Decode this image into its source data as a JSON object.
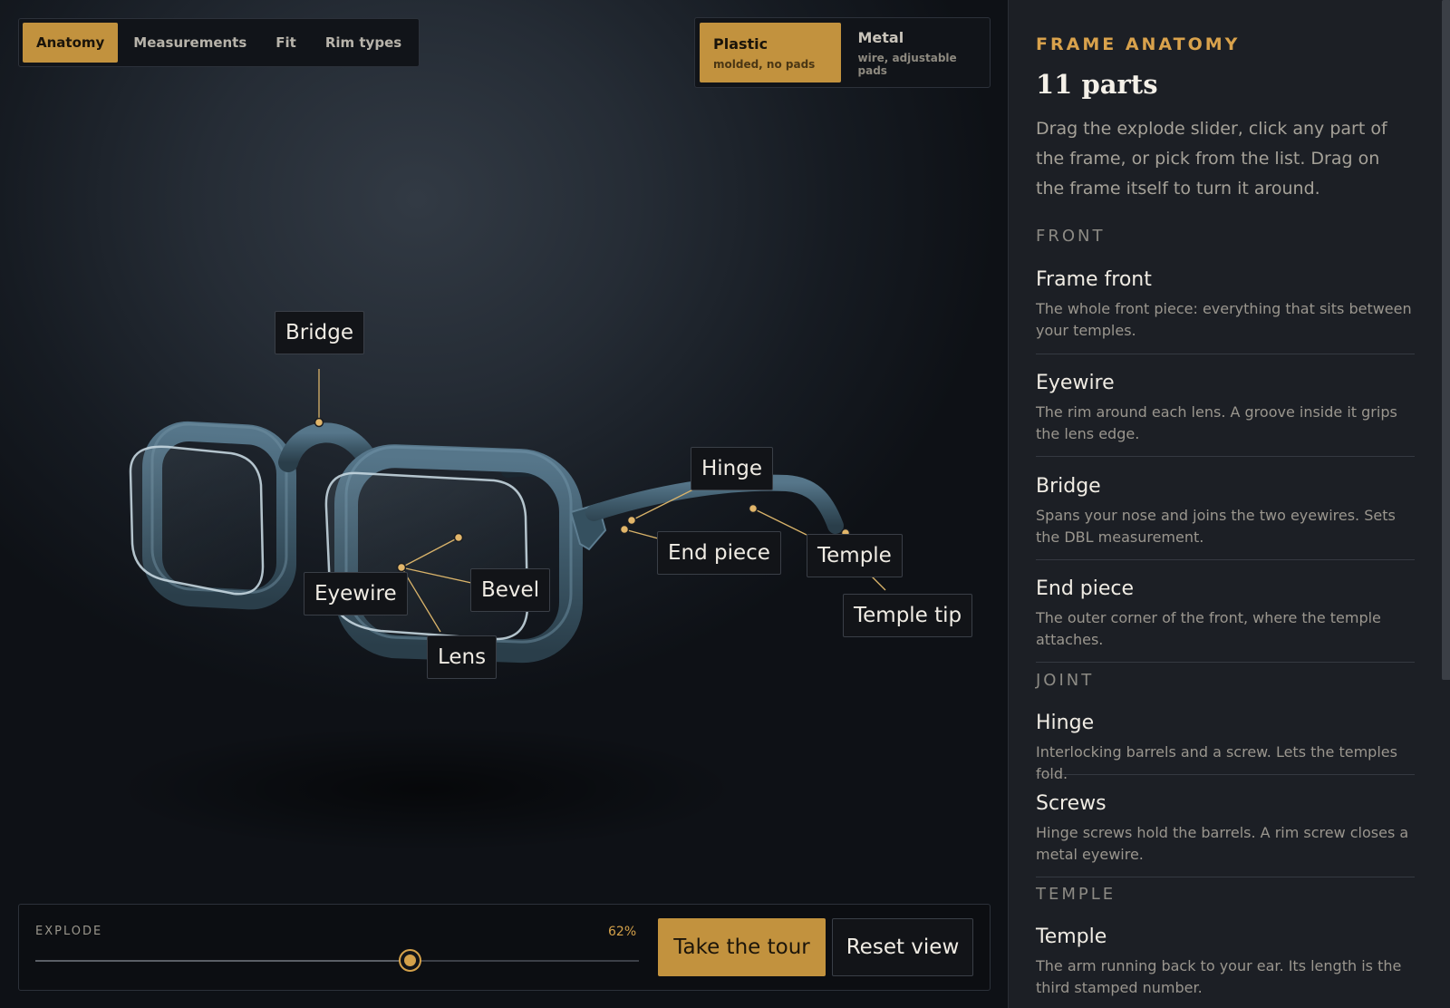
{
  "mode_tabs": {
    "anatomy": "Anatomy",
    "measurements": "Measurements",
    "fit": "Fit",
    "rim_types": "Rim types"
  },
  "material": {
    "plastic": {
      "name": "Plastic",
      "sub": "molded, no pads"
    },
    "metal": {
      "name": "Metal",
      "sub": "wire, adjustable pads"
    }
  },
  "labels": {
    "bridge": "Bridge",
    "hinge": "Hinge",
    "end_piece": "End piece",
    "temple": "Temple",
    "temple_tip": "Temple tip",
    "eyewire": "Eyewire",
    "bevel": "Bevel",
    "lens": "Lens"
  },
  "explode": {
    "label": "EXPLODE",
    "value_text": "62%",
    "value": 0.62
  },
  "buttons": {
    "tour": "Take the tour",
    "reset": "Reset view"
  },
  "colors": {
    "accent": "#c2923e",
    "frame": "#3e5a6b",
    "panel": "#1c1f25"
  },
  "panel": {
    "eyebrow": "FRAME ANATOMY",
    "count": "11 parts",
    "intro": "Drag the explode slider, click any part of the frame, or pick from the list. Drag on the frame itself to turn it around.",
    "groups": {
      "front": "FRONT",
      "joint": "JOINT",
      "temple": "TEMPLE"
    },
    "parts": {
      "frame_front": {
        "name": "Frame front",
        "desc": "The whole front piece: everything that sits between your temples."
      },
      "eyewire": {
        "name": "Eyewire",
        "desc": "The rim around each lens. A groove inside it grips the lens edge."
      },
      "bridge": {
        "name": "Bridge",
        "desc": "Spans your nose and joins the two eyewires. Sets the DBL measurement."
      },
      "end_piece": {
        "name": "End piece",
        "desc": "The outer corner of the front, where the temple attaches."
      },
      "hinge": {
        "name": "Hinge",
        "desc": "Interlocking barrels and a screw. Lets the temples fold."
      },
      "screws": {
        "name": "Screws",
        "desc": "Hinge screws hold the barrels. A rim screw closes a metal eyewire."
      },
      "temple": {
        "name": "Temple",
        "desc": "The arm running back to your ear. Its length is the third stamped number."
      }
    }
  }
}
